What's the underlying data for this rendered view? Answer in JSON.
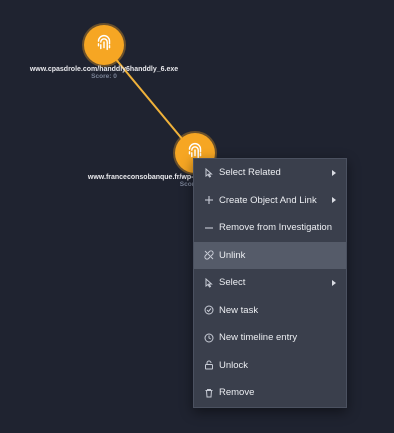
{
  "graph": {
    "nodes": [
      {
        "label": "www.cpasdrole.com/handdly6handdly_6.exe",
        "score": "Score: 0",
        "icon": "fingerprint-icon"
      },
      {
        "label": "www.franceconsobanque.fr/wp-admin/ima",
        "score": "Scor",
        "icon": "fingerprint-icon"
      }
    ],
    "colors": {
      "background": "#1f2330",
      "node": "#f6a623",
      "edge": "#f0b23a"
    }
  },
  "context_menu": {
    "items": [
      {
        "label": "Select Related",
        "icon": "cursor-pointer-icon",
        "submenu": true
      },
      {
        "label": "Create Object And Link",
        "icon": "plus-icon",
        "submenu": true
      },
      {
        "label": "Remove from Investigation",
        "icon": "minus-icon",
        "submenu": false
      },
      {
        "label": "Unlink",
        "icon": "unlink-icon",
        "submenu": false,
        "highlighted": true
      },
      {
        "label": "Select",
        "icon": "cursor-pointer-icon",
        "submenu": true
      },
      {
        "label": "New task",
        "icon": "check-circle-icon",
        "submenu": false
      },
      {
        "label": "New timeline entry",
        "icon": "clock-icon",
        "submenu": false
      },
      {
        "label": "Unlock",
        "icon": "unlock-icon",
        "submenu": false
      },
      {
        "label": "Remove",
        "icon": "trash-icon",
        "submenu": false
      }
    ]
  }
}
